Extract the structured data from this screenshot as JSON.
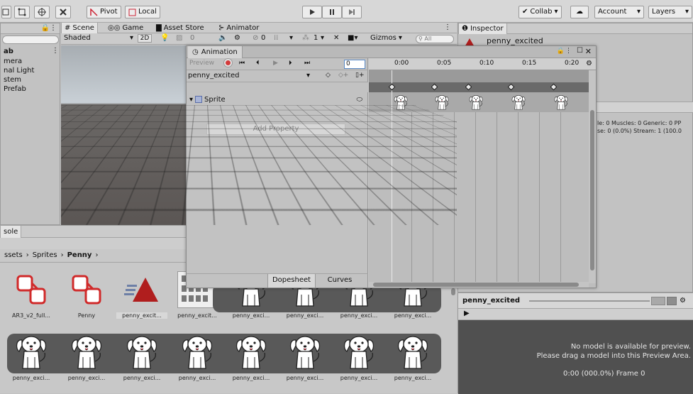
{
  "toolbar": {
    "pivot_label": "Pivot",
    "local_label": "Local",
    "collab_label": "Collab",
    "account_label": "Account",
    "layers_label": "Layers"
  },
  "hierarchy": {
    "items": [
      "ab",
      "mera",
      "nal Light",
      "stem",
      "Prefab"
    ]
  },
  "scene_tabs": {
    "scene": "Scene",
    "game": "Game",
    "asset_store": "Asset Store",
    "animator": "Animator",
    "shaded": "Shaded",
    "two_d": "2D",
    "gizmos": "Gizmos",
    "search_placeholder": "All",
    "layer_count": "0",
    "fx_count": "0",
    "page": "1"
  },
  "animation": {
    "title": "Animation",
    "preview_label": "Preview",
    "frame_value": "0",
    "clip_name": "penny_excited",
    "property_name": "Sprite",
    "add_property": "Add Property",
    "dopesheet_tab": "Dopesheet",
    "curves_tab": "Curves",
    "ruler": [
      "0:00",
      "0:05",
      "0:10",
      "0:15",
      "0:20"
    ],
    "keyframe_count": 5
  },
  "inspector": {
    "title": "Inspector",
    "object_name": "penny_excited",
    "stats_line1": "le: 0 Muscles: 0 Generic: 0 PP",
    "stats_line2": "se: 0 (0.0%) Stream: 1 (100.0",
    "preview_name": "penny_excited",
    "no_model_line1": "No model is available for preview.",
    "no_model_line2": "Please drag a model into this Preview Area.",
    "frame_info": "0:00 (000.0%) Frame 0"
  },
  "console": {
    "title": "sole"
  },
  "project": {
    "breadcrumb": [
      "ssets",
      "Sprites",
      "Penny"
    ],
    "row1": [
      "AR3_v2_full...",
      "Penny",
      "penny_excit...",
      "penny_excit...",
      "penny_exci...",
      "penny_exci...",
      "penny_exci...",
      "penny_exci..."
    ],
    "row2": [
      "penny_exci...",
      "penny_exci...",
      "penny_exci...",
      "penny_exci...",
      "penny_exci...",
      "penny_exci...",
      "penny_exci...",
      "penny_exci..."
    ]
  },
  "colors": {
    "record_red": "#d33a3a",
    "anim_triangle": "#b01e1e",
    "prefab_red": "#d02a2a",
    "strip_dark": "#595959"
  }
}
